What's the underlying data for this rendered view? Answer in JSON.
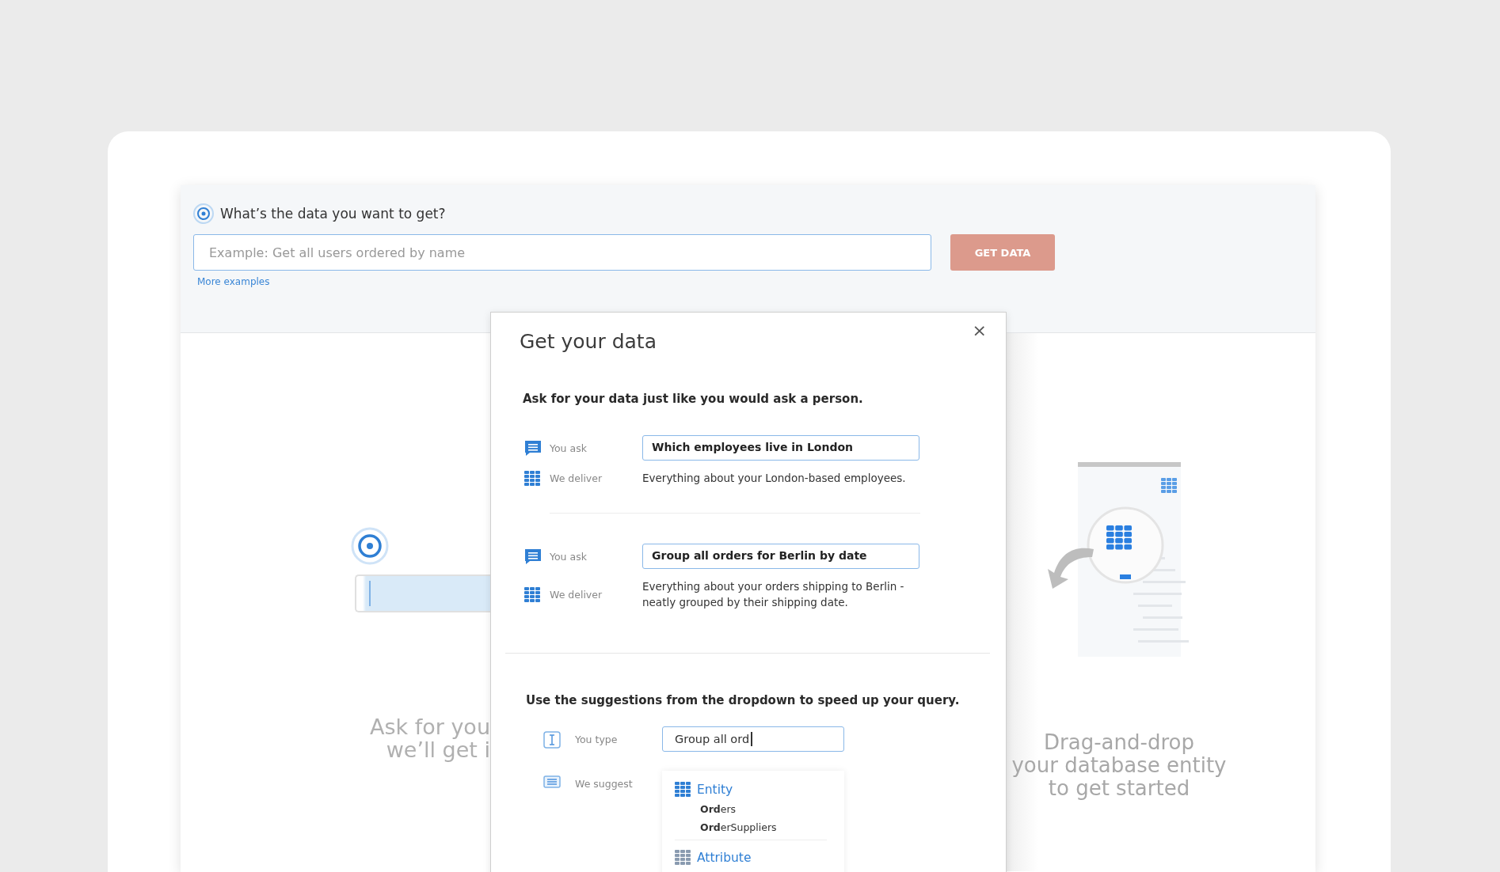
{
  "header": {
    "title": "What’s the data you want to get?",
    "query": {
      "placeholder": "Example: Get all users ordered by name"
    },
    "button": "GET DATA",
    "link": "More examples"
  },
  "left_panel": {
    "lines": [
      "Ask for you",
      "we’ll get i"
    ]
  },
  "right_panel": {
    "lines": [
      "Drag-and-drop",
      "your database entity",
      "to get started"
    ]
  },
  "modal": {
    "title": "Get your data",
    "close": "×",
    "intro": "Ask for your data just like you would ask a person.",
    "examples": [
      {
        "ask_label": "You ask",
        "query": "Which employees live in London",
        "deliver_label": "We deliver",
        "deliver": "Everything about your London-based employees."
      },
      {
        "ask_label": "You ask",
        "query": "Group all orders for Berlin by date",
        "deliver_label": "We deliver",
        "deliver": "Everything about your orders shipping to Berlin - neatly grouped by their shipping date."
      }
    ],
    "tip": "Use the suggestions from the dropdown to speed up your query.",
    "typing": {
      "label": "You type",
      "value": "Group all ord",
      "suggest_label": "We suggest",
      "groups": [
        {
          "title": "Entity",
          "items": [
            "**Ord**ers",
            "**Ord**erSuppliers"
          ]
        },
        {
          "title": "Attribute"
        }
      ]
    }
  }
}
